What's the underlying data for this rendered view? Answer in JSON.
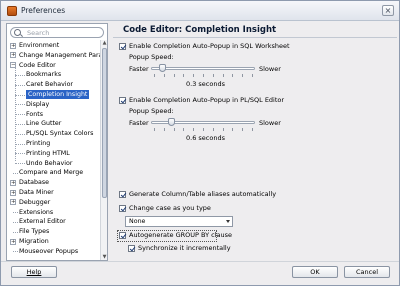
{
  "window": {
    "title": "Preferences"
  },
  "search": {
    "placeholder": "Search"
  },
  "tree": {
    "items": [
      {
        "label": "Environment",
        "expander": "+"
      },
      {
        "label": "Change Management Param",
        "expander": "+"
      },
      {
        "label": "Code Editor",
        "expander": "−"
      },
      {
        "label": "Bookmarks"
      },
      {
        "label": "Caret Behavior"
      },
      {
        "label": "Completion Insight",
        "selected": true
      },
      {
        "label": "Display"
      },
      {
        "label": "Fonts"
      },
      {
        "label": "Line Gutter"
      },
      {
        "label": "PL/SQL Syntax Colors"
      },
      {
        "label": "Printing"
      },
      {
        "label": "Printing HTML"
      },
      {
        "label": "Undo Behavior"
      },
      {
        "label": "Compare and Merge"
      },
      {
        "label": "Database",
        "expander": "+"
      },
      {
        "label": "Data Miner",
        "expander": "+"
      },
      {
        "label": "Debugger",
        "expander": "+"
      },
      {
        "label": "Extensions"
      },
      {
        "label": "External Editor"
      },
      {
        "label": "File Types"
      },
      {
        "label": "Migration",
        "expander": "+"
      },
      {
        "label": "Mouseover Popups"
      }
    ]
  },
  "panel": {
    "heading": "Code Editor: Completion Insight",
    "sql_popup": {
      "checkbox_label": "Enable Completion Auto-Popup in SQL Worksheet",
      "checked": true,
      "speed_label": "Popup Speed:",
      "faster": "Faster",
      "slower": "Slower",
      "value_text": "0.3 seconds",
      "slider_level": 0.08
    },
    "plsql_popup": {
      "checkbox_label": "Enable Completion Auto-Popup in PL/SQL Editor",
      "checked": true,
      "speed_label": "Popup Speed:",
      "faster": "Faster",
      "slower": "Slower",
      "value_text": "0.6 seconds",
      "slider_level": 0.18
    },
    "generate_aliases": {
      "label": "Generate Column/Table aliases automatically",
      "checked": true
    },
    "change_case": {
      "label": "Change case as you type",
      "checked": true
    },
    "case_dropdown": {
      "value": "None"
    },
    "autogen_group_by": {
      "label": "Autogenerate GROUP BY clause",
      "checked": true
    },
    "sync_incrementally": {
      "label": "Synchronize it incrementally",
      "checked": true
    }
  },
  "buttons": {
    "help": "Help",
    "ok": "OK",
    "cancel": "Cancel"
  },
  "colors": {
    "selection": "#2a63c6",
    "window_bg": "#eeedef"
  }
}
